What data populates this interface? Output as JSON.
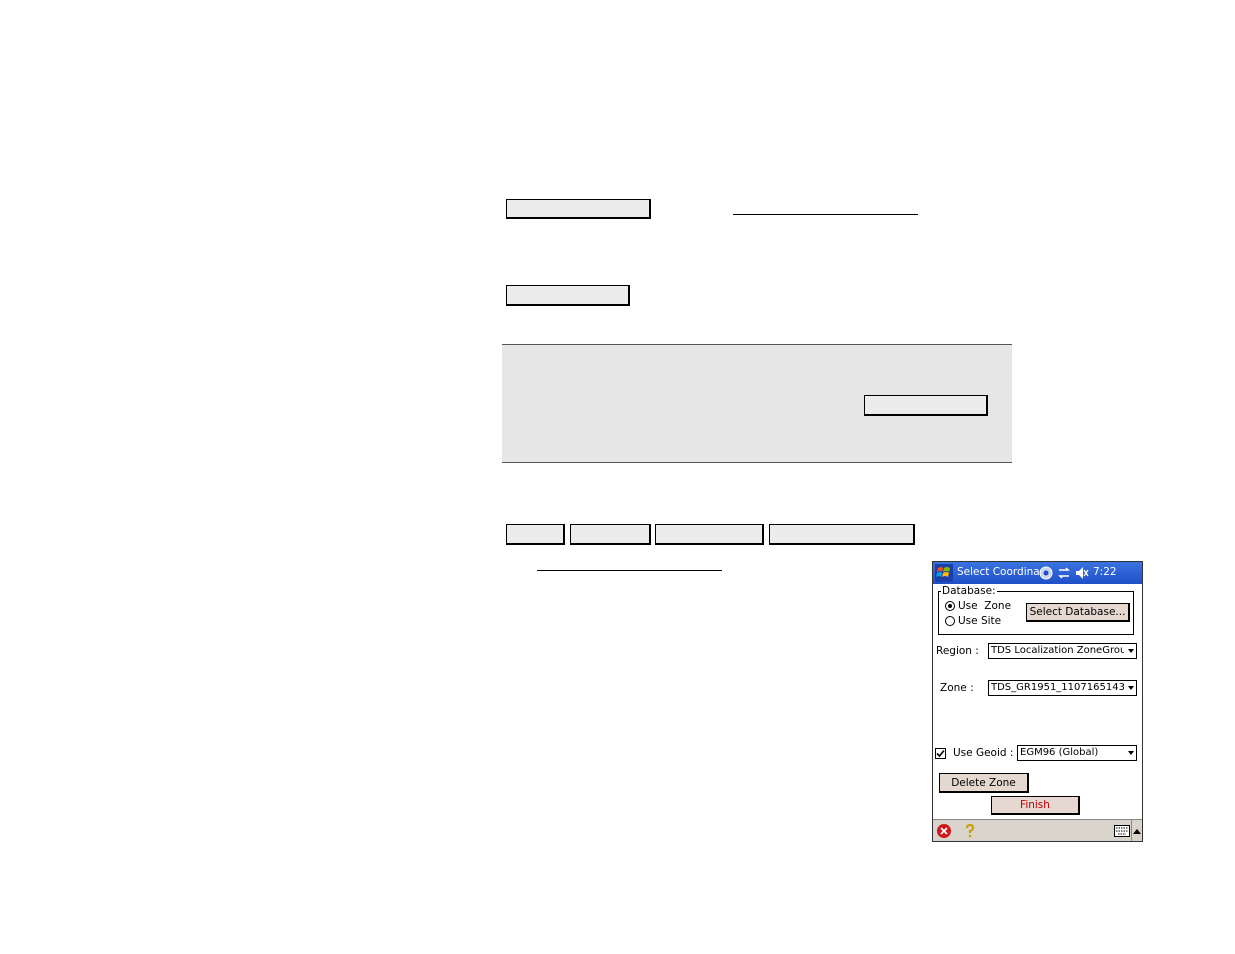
{
  "device": {
    "title": "Select Coordina",
    "time": "7:22",
    "database_group": "Database:",
    "radio_use_zone": "Use  Zone",
    "radio_use_site": "Use Site",
    "select_database_label": "Select Database...",
    "region_label": "Region :",
    "region_value": "TDS Localization ZoneGroup",
    "zone_label": "Zone :",
    "zone_value": "TDS_GR1951_1107165143",
    "use_geoid_label": "Use Geoid :",
    "geoid_value": "EGM96 (Global)",
    "delete_zone_label": "Delete Zone",
    "finish_label": "Finish",
    "colors": {
      "titlebar": "#1f4fc7",
      "button_face": "#e4d8d0",
      "finish_text": "#c00000"
    },
    "icons": [
      "windows-start-icon",
      "connectivity-icon",
      "sync-icon",
      "speaker-mute-icon",
      "close-icon",
      "help-icon",
      "keyboard-icon",
      "up-arrow-icon"
    ]
  }
}
